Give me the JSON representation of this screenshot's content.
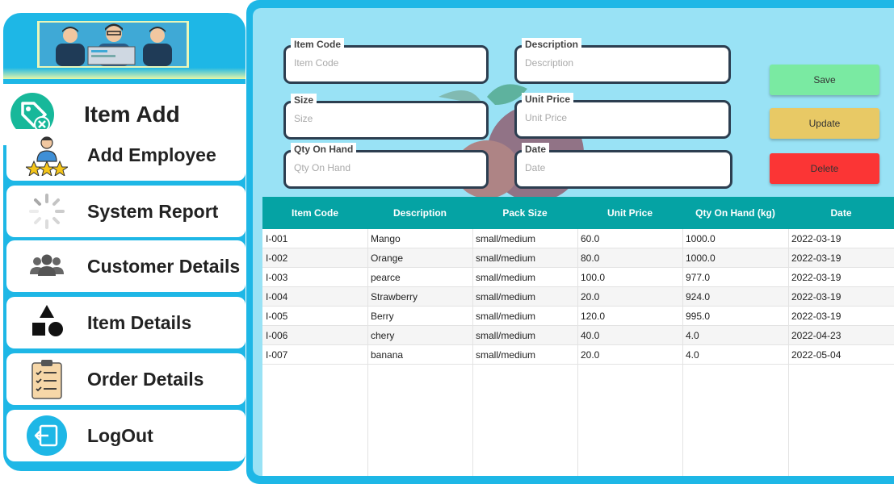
{
  "sidebar": {
    "active": {
      "label": "Item Add",
      "icon": "tag-remove-icon"
    },
    "items": [
      {
        "label": "Add Employee",
        "icon": "employee-stars-icon"
      },
      {
        "label": "System Report",
        "icon": "loading-spinner-icon"
      },
      {
        "label": "Customer Details",
        "icon": "users-group-icon"
      },
      {
        "label": "Item Details",
        "icon": "shapes-icon"
      },
      {
        "label": "Order Details",
        "icon": "clipboard-checklist-icon"
      },
      {
        "label": "LogOut",
        "icon": "logout-icon"
      }
    ]
  },
  "form": {
    "item_code": {
      "label": "Item Code",
      "placeholder": "Item Code"
    },
    "description": {
      "label": "Description",
      "placeholder": "Description"
    },
    "size": {
      "label": "Size",
      "placeholder": "Size"
    },
    "unit_price": {
      "label": "Unit Price",
      "placeholder": "Unit Price"
    },
    "qty_on_hand": {
      "label": "Qty On Hand",
      "placeholder": "Qty On Hand"
    },
    "date": {
      "label": "Date",
      "placeholder": "Date"
    }
  },
  "buttons": {
    "save": "Save",
    "update": "Update",
    "delete": "Delete"
  },
  "colors": {
    "save": "#7aeaa2",
    "update": "#e8c965",
    "delete": "#fb3535",
    "header": "#05a3a4",
    "frame": "#1eb7e6",
    "panel": "#99e2f5"
  },
  "table": {
    "headers": [
      "Item Code",
      "Description",
      "Pack Size",
      "Unit Price",
      "Qty On Hand (kg)",
      "Date"
    ],
    "rows": [
      [
        "I-001",
        "Mango",
        "small/medium",
        "60.0",
        "1000.0",
        "2022-03-19"
      ],
      [
        "I-002",
        "Orange",
        "small/medium",
        "80.0",
        "1000.0",
        "2022-03-19"
      ],
      [
        "I-003",
        "pearce",
        "small/medium",
        "100.0",
        "977.0",
        "2022-03-19"
      ],
      [
        "I-004",
        "Strawberry",
        "small/medium",
        "20.0",
        "924.0",
        "2022-03-19"
      ],
      [
        "I-005",
        "Berry",
        "small/medium",
        "120.0",
        "995.0",
        "2022-03-19"
      ],
      [
        "I-006",
        "chery",
        "small/medium",
        "40.0",
        "4.0",
        "2022-04-23"
      ],
      [
        "I-007",
        "banana",
        "small/medium",
        "20.0",
        "4.0",
        "2022-05-04"
      ]
    ]
  }
}
